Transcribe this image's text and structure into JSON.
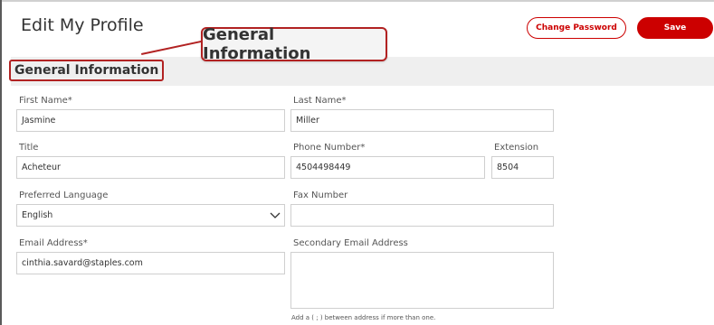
{
  "header": {
    "title": "Edit My Profile",
    "change_password_label": "Change Password",
    "save_label": "Save"
  },
  "callout": {
    "text": "General Information"
  },
  "section": {
    "title": "General Information"
  },
  "form": {
    "first_name": {
      "label": "First Name*",
      "value": "Jasmine"
    },
    "last_name": {
      "label": "Last Name*",
      "value": "Miller"
    },
    "title": {
      "label": "Title",
      "value": "Acheteur"
    },
    "phone": {
      "label": "Phone Number*",
      "value": "4504498449"
    },
    "extension": {
      "label": "Extension",
      "value": "8504"
    },
    "preferred_language": {
      "label": "Preferred Language",
      "value": "English"
    },
    "fax": {
      "label": "Fax Number",
      "value": ""
    },
    "email": {
      "label": "Email Address*",
      "value": "cinthia.savard@staples.com"
    },
    "secondary_email": {
      "label": "Secondary Email Address",
      "value": "",
      "hint": "Add a ( ; ) between address if more than one."
    }
  },
  "colors": {
    "accent": "#cc0000",
    "annotation": "#b22222",
    "section_bg": "#efefef"
  }
}
